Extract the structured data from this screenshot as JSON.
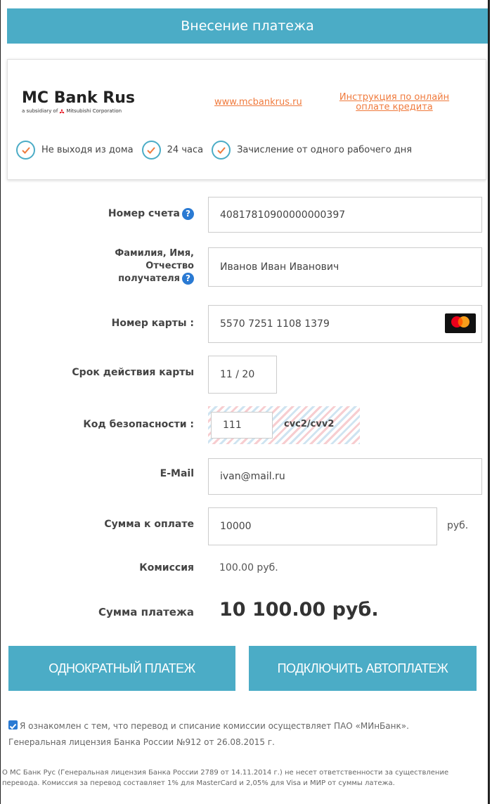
{
  "header": {
    "title": "Внесение платежа"
  },
  "info": {
    "logo_main": "MC Bank Rus",
    "logo_sub_prefix": "a subsidiary of",
    "logo_sub_suffix": "Mitsubishi Corporation",
    "site_link": "www.mcbankrus.ru",
    "instructions_link": "Инструкция по онлайн оплате кредита",
    "features": [
      "Не выходя из дома",
      "24 часа",
      "Зачисление от одного рабочего дня"
    ]
  },
  "form": {
    "account_label": "Номер счета",
    "account_value": "40817810900000000397",
    "name_label_line1": "Фамилия, Имя,",
    "name_label_line2": "Отчество",
    "name_label_line3": "получателя",
    "name_value": "Иванов Иван Иванович",
    "card_label": "Номер карты :",
    "card_value": "5570 7251 1108 1379",
    "expiry_label": "Срок действия карты",
    "expiry_value": "11 / 20",
    "cvc_label": "Код безопасности :",
    "cvc_value": "111",
    "cvc_hint": "cvc2/cvv2",
    "email_label": "E-Mail",
    "email_value": "ivan@mail.ru",
    "amount_label": "Сумма к оплате",
    "amount_value": "10000",
    "amount_unit": "руб.",
    "commission_label": "Комиссия",
    "commission_value": "100.00 руб.",
    "total_label": "Сумма платежа",
    "total_value": "10 100.00 руб.",
    "help_glyph": "?"
  },
  "buttons": {
    "single_payment": "ОДНОКРАТНЫЙ ПЛАТЕЖ",
    "autopay": "ПОДКЛЮЧИТЬ АВТОПЛАТЕЖ"
  },
  "agreement": {
    "checked": true,
    "line1": "Я ознакомлен с тем, что перевод и списание комиссии осуществляет ПАО «МИнБанк».",
    "line2": "Генеральная лицензия Банка России №912 от 26.08.2015 г."
  },
  "footnote": "О МС Банк Рус (Генеральная лицензия Банка России 2789 от 14.11.2014 г.) не несет ответственности за существление перевода. Комиссия за перевод составляет 1% для MasterCard и 2,05% для Visa и МИР от суммы латежа.",
  "colors": {
    "accent": "#4bacc6",
    "link": "#f07a3c",
    "help": "#2a7ad3"
  },
  "icons": {
    "feature": "check-circle-icon",
    "card_brand": "mastercard-icon",
    "help": "question-circle-icon"
  }
}
